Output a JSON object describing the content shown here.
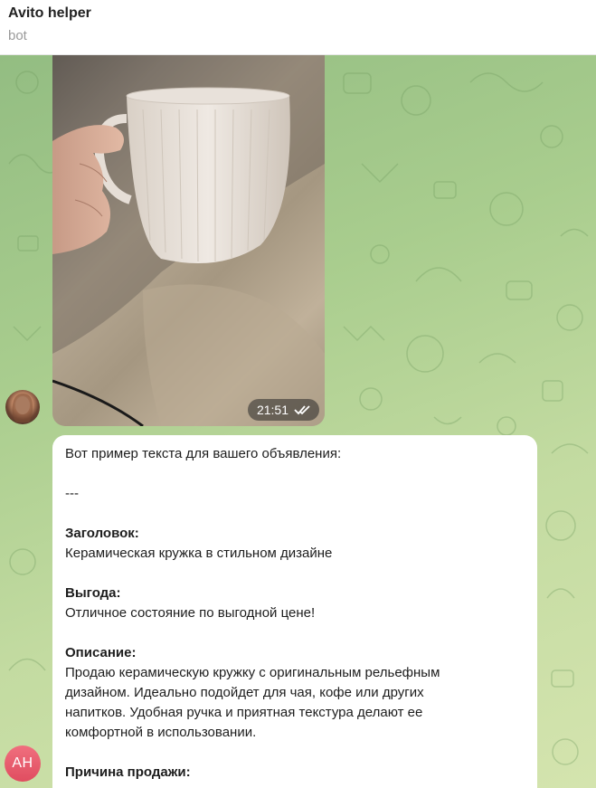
{
  "header": {
    "title": "Avito helper",
    "subtitle": "bot"
  },
  "photo_message": {
    "time": "21:51",
    "status_icon": "double-check-icon"
  },
  "text_message": {
    "intro": "Вот пример текста для вашего объявления:",
    "separator": "---",
    "title_label": "Заголовок:",
    "title_value": "Керамическая кружка в стильном дизайне",
    "benefit_label": "Выгода:",
    "benefit_value": "Отличное состояние по выгодной цене!",
    "description_label": "Описание:",
    "description_lines": [
      "Продаю керамическую кружку с оригинальным рельефным",
      "дизайном. Идеально подойдет для чая, кофе или других",
      "напитков. Удобная ручка и приятная текстура делают ее",
      "комфортной в использовании."
    ],
    "reason_label": "Причина продажи:"
  },
  "bot_avatar": {
    "initials": "AH",
    "color": "#e85a6b"
  },
  "colors": {
    "chat_background": "#a9cd8e",
    "bubble": "#ffffff"
  }
}
